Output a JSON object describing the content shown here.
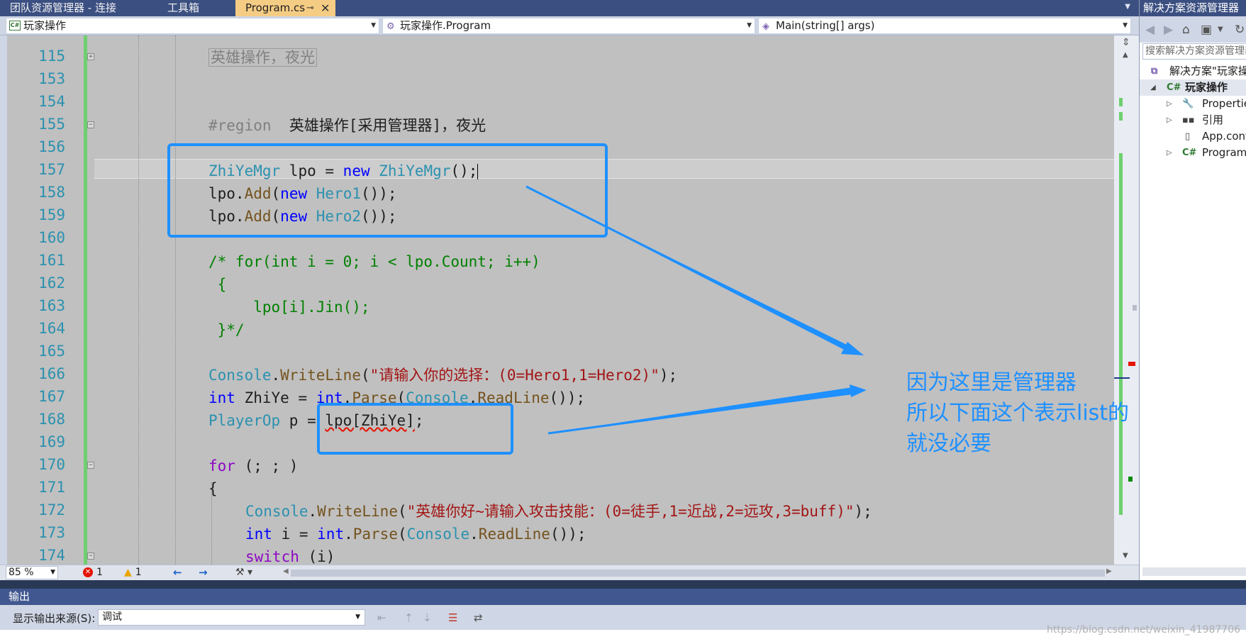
{
  "tabs": [
    {
      "label": "团队资源管理器 - 连接"
    },
    {
      "label": "工具箱"
    },
    {
      "label": "Program.cs",
      "active": true,
      "pin": "⊸",
      "close": "✕"
    }
  ],
  "navbar": {
    "project": "玩家操作",
    "class": "玩家操作.Program",
    "member": "Main(string[] args)"
  },
  "line_numbers": [
    "115",
    "153",
    "154",
    "155",
    "156",
    "157",
    "158",
    "159",
    "160",
    "161",
    "162",
    "163",
    "164",
    "165",
    "166",
    "167",
    "168",
    "169",
    "170",
    "171",
    "172",
    "173",
    "174"
  ],
  "code": {
    "l115": "英雄操作，夜光",
    "l155_region": "#region",
    "l155_text": "英雄操作[采用管理器]，夜光",
    "l157": {
      "t1": "ZhiYeMgr",
      "t2": " lpo = ",
      "t3": "new",
      "t4": " ",
      "t5": "ZhiYeMgr",
      "t6": "();"
    },
    "l158": {
      "t1": "lpo.",
      "t2": "Add",
      "t3": "(",
      "t4": "new",
      "t5": " ",
      "t6": "Hero1",
      "t7": "());"
    },
    "l159": {
      "t1": "lpo.",
      "t2": "Add",
      "t3": "(",
      "t4": "new",
      "t5": " ",
      "t6": "Hero2",
      "t7": "());"
    },
    "l161": "/* for(int i = 0; i < lpo.Count; i++)",
    "l162": " {",
    "l163": "     lpo[i].Jin();",
    "l164": " }*/",
    "l166": {
      "t1": "Console",
      "t2": ".",
      "t3": "WriteLine",
      "t4": "(",
      "t5": "\"请输入你的选择：(0=Hero1,1=Hero2)\"",
      "t6": ");"
    },
    "l167": {
      "t1": "int",
      "t2": " ZhiYe = ",
      "t3": "int",
      "t4": ".",
      "t5": "Parse",
      "t6": "(",
      "t7": "Console",
      "t8": ".",
      "t9": "ReadLine",
      "t10": "());"
    },
    "l168": {
      "t1": "PlayerOp",
      "t2": " p = ",
      "t3": "lpo[ZhiYe]",
      "t4": ";"
    },
    "l170": {
      "t1": "for",
      "t2": " (; ; )"
    },
    "l171": "{",
    "l172": {
      "t1": "Console",
      "t2": ".",
      "t3": "WriteLine",
      "t4": "(",
      "t5": "\"英雄你好~请输入攻击技能：(0=徒手,1=近战,2=远攻,3=buff)\"",
      "t6": ");"
    },
    "l173": {
      "t1": "int",
      "t2": " i = ",
      "t3": "int",
      "t4": ".",
      "t5": "Parse",
      "t6": "(",
      "t7": "Console",
      "t8": ".",
      "t9": "ReadLine",
      "t10": "());"
    },
    "l174": {
      "t1": "switch",
      "t2": " (i)"
    }
  },
  "annotation": {
    "text": "因为这里是管理器\n所以下面这个表示list的\n就没必要",
    "color": "#1e90ff"
  },
  "editbar": {
    "zoom": "85 %",
    "errors": "1",
    "warnings": "1",
    "back_arrow": "←",
    "forward_arrow": "→"
  },
  "solution_explorer": {
    "title": "解决方案资源管理器",
    "search_placeholder": "搜索解决方案资源管理器",
    "items": [
      {
        "label": "解决方案\"玩家操作\"",
        "icon": "solution-icon"
      },
      {
        "label": "玩家操作",
        "icon": "csharp-project-icon"
      },
      {
        "label": "Properties",
        "icon": "wrench-icon"
      },
      {
        "label": "引用",
        "icon": "references-icon"
      },
      {
        "label": "App.config",
        "icon": "config-file-icon"
      },
      {
        "label": "Program.cs",
        "icon": "csharp-file-icon"
      }
    ]
  },
  "output": {
    "title": "输出",
    "source_label": "显示输出来源(S):",
    "source_value": "调试"
  },
  "watermark": "https://blog.csdn.net/weixin_41987706",
  "colors": {
    "editor_bg": "#c0c0c0",
    "keyword": "#0000ff",
    "type": "#2b91af",
    "string": "#a31515",
    "comment": "#008000",
    "method": "#74531f",
    "control": "#8f08c4",
    "annotation": "#1e90ff",
    "tab_active": "#f5cc84",
    "chrome": "#3b4f81"
  }
}
